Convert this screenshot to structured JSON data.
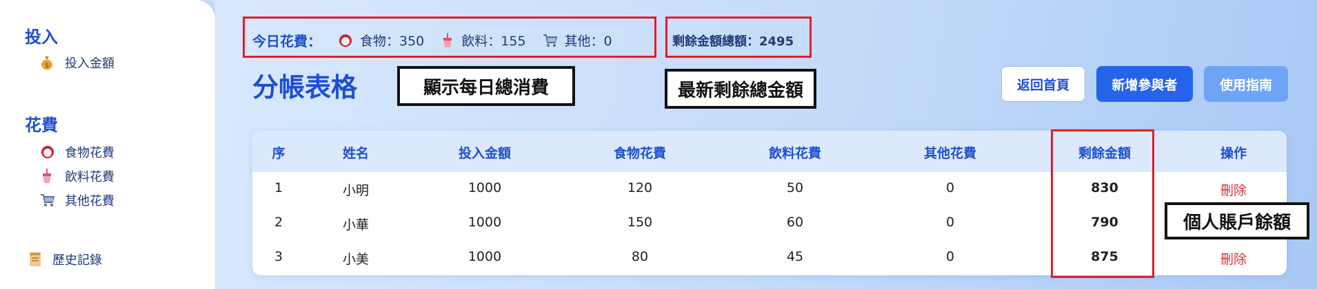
{
  "sidebar": {
    "invest_title": "投入",
    "invest_items": [
      {
        "icon": "money-bag-icon",
        "label": "投入金額"
      }
    ],
    "spend_title": "花費",
    "spend_items": [
      {
        "icon": "food-icon",
        "label": "食物花費"
      },
      {
        "icon": "drink-icon",
        "label": "飲料花費"
      },
      {
        "icon": "cart-icon",
        "label": "其他花費"
      }
    ],
    "history_label": "歷史記錄"
  },
  "summary": {
    "today_label": "今日花費：",
    "food": "食物：350",
    "drink": "飲料：155",
    "other": "其他：0",
    "remaining_total": "剩餘金額總額：2495"
  },
  "annotations": {
    "daily_total": "顯示每日總消費",
    "latest_remaining": "最新剩餘總金額",
    "personal_balance": "個人賬戶餘額"
  },
  "page_title": "分帳表格",
  "buttons": {
    "home": "返回首頁",
    "add_participant": "新增參與者",
    "guide": "使用指南"
  },
  "table": {
    "headers": [
      "序",
      "姓名",
      "投入金額",
      "食物花費",
      "飲料花費",
      "其他花費",
      "剩餘金額",
      "操作"
    ],
    "rows": [
      [
        "1",
        "小明",
        "1000",
        "120",
        "50",
        "0",
        "830",
        "刪除"
      ],
      [
        "2",
        "小華",
        "1000",
        "150",
        "60",
        "0",
        "790",
        ""
      ],
      [
        "3",
        "小美",
        "1000",
        "80",
        "45",
        "0",
        "875",
        "刪除"
      ]
    ]
  },
  "colors": {
    "accent": "#1d4fd0",
    "primary_button": "#2563eb",
    "delete": "#e0323a",
    "highlight_box": "#e01e2b"
  }
}
